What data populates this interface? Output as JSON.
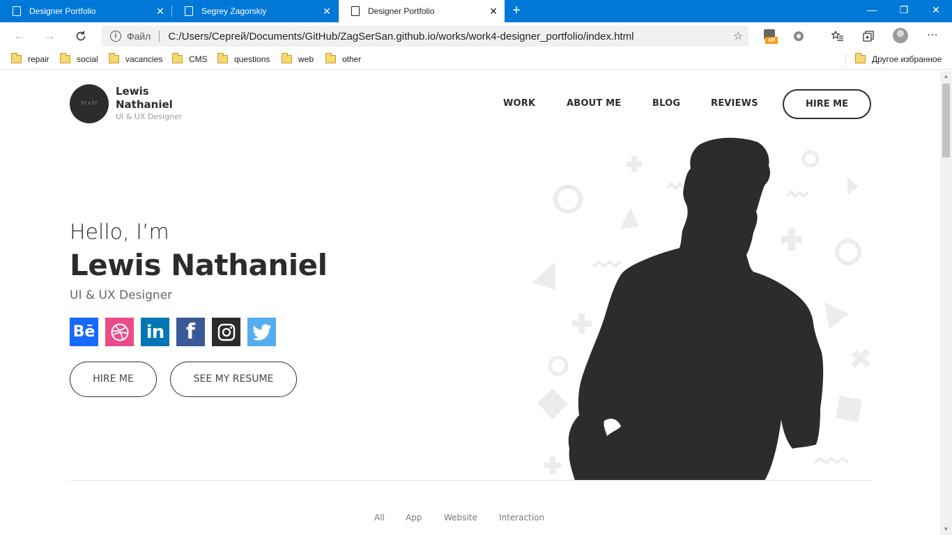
{
  "browser": {
    "tabs": [
      {
        "title": "Designer Portfolio",
        "active": false
      },
      {
        "title": "Segrey Zagorskiy",
        "active": false
      },
      {
        "title": "Designer Portfolio",
        "active": true
      }
    ],
    "new_tab_glyph": "+",
    "window_buttons": [
      "—",
      "❐",
      "✕"
    ],
    "address": {
      "info_glyph": "i",
      "scheme_label": "Файл",
      "url": "C:/Users/Сергей/Documents/GitHub/ZagSerSan.github.io/works/work4-designer_portfolio/index.html"
    },
    "extension_badge": "off",
    "bookmarks": [
      "repair",
      "social",
      "vacancies",
      "CMS",
      "questions",
      "web",
      "other"
    ],
    "other_bookmarks": "Другое избранное"
  },
  "site": {
    "logo_placeholder": "57 x 57",
    "brand_name": "Lewis Nathaniel",
    "brand_role": "UI & UX Designer",
    "menu": [
      "WORK",
      "ABOUT ME",
      "BLOG",
      "REVIEWS"
    ],
    "hire_cta": "HIRE ME",
    "hero": {
      "greeting": "Hello, I’m",
      "name": "Lewis Nathaniel",
      "role": "UI & UX Designer"
    },
    "socials": [
      {
        "name": "behance",
        "glyph": "Bē",
        "color": "#1769ff"
      },
      {
        "name": "dribbble",
        "glyph": "",
        "color": "#ea4c89"
      },
      {
        "name": "linkedin",
        "glyph": "in",
        "color": "#0077b5"
      },
      {
        "name": "facebook",
        "glyph": "f",
        "color": "#3b5998"
      },
      {
        "name": "instagram",
        "glyph": "",
        "color": "#2c2c2c"
      },
      {
        "name": "twitter",
        "glyph": "",
        "color": "#55acee"
      }
    ],
    "buttons": {
      "hire": "HIRE ME",
      "resume": "SEE MY RESUME"
    },
    "filters": [
      "All",
      "App",
      "Website",
      "Interaction"
    ]
  }
}
